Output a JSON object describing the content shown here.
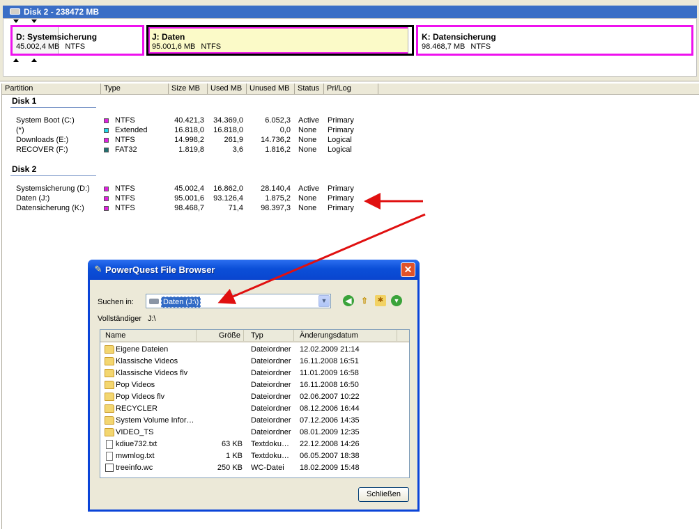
{
  "disk_map": {
    "header": "Disk 2 - 238472 MB",
    "partitions": [
      {
        "name": "D:  Systemsicherung",
        "size": "45.002,4 MB",
        "fs": "NTFS"
      },
      {
        "name": "J:  Daten",
        "size": "95.001,6 MB",
        "fs": "NTFS"
      },
      {
        "name": "K:  Datensicherung",
        "size": "98.468,7 MB",
        "fs": "NTFS"
      }
    ]
  },
  "list": {
    "columns": [
      "Partition",
      "Type",
      "Size MB",
      "Used MB",
      "Unused MB",
      "Status",
      "Pri/Log"
    ],
    "groups": [
      {
        "title": "Disk 1",
        "rows": [
          {
            "partition": "System Boot (C:)",
            "color": "#e020e0",
            "type": "NTFS",
            "size": "40.421,3",
            "used": "34.369,0",
            "unused": "6.052,3",
            "status": "Active",
            "prilog": "Primary"
          },
          {
            "partition": "(*)",
            "color": "#20d8e8",
            "type": "Extended",
            "size": "16.818,0",
            "used": "16.818,0",
            "unused": "0,0",
            "status": "None",
            "prilog": "Primary"
          },
          {
            "partition": "Downloads (E:)",
            "color": "#e020e0",
            "type": "NTFS",
            "size": "14.998,2",
            "used": "261,9",
            "unused": "14.736,2",
            "status": "None",
            "prilog": "Logical"
          },
          {
            "partition": "RECOVER (F:)",
            "color": "#207070",
            "type": "FAT32",
            "size": "1.819,8",
            "used": "3,6",
            "unused": "1.816,2",
            "status": "None",
            "prilog": "Logical"
          }
        ]
      },
      {
        "title": "Disk 2",
        "rows": [
          {
            "partition": "Systemsicherung (D:)",
            "color": "#e020e0",
            "type": "NTFS",
            "size": "45.002,4",
            "used": "16.862,0",
            "unused": "28.140,4",
            "status": "Active",
            "prilog": "Primary"
          },
          {
            "partition": "Daten (J:)",
            "color": "#e020e0",
            "type": "NTFS",
            "size": "95.001,6",
            "used": "93.126,4",
            "unused": "1.875,2",
            "status": "None",
            "prilog": "Primary"
          },
          {
            "partition": "Datensicherung (K:)",
            "color": "#e020e0",
            "type": "NTFS",
            "size": "98.468,7",
            "used": "71,4",
            "unused": "98.397,3",
            "status": "None",
            "prilog": "Primary"
          }
        ]
      }
    ]
  },
  "dialog": {
    "title": "PowerQuest File Browser",
    "lookin_label": "Suchen in:",
    "lookin_value": "Daten (J:\\)",
    "fullpath_label": "Vollständiger",
    "fullpath_value": "J:\\",
    "columns": {
      "name": "Name",
      "size": "Größe",
      "type": "Typ",
      "date": "Änderungsdatum"
    },
    "files": [
      {
        "icon": "folder-icon",
        "name": "Eigene Dateien",
        "size": "",
        "type": "Dateiordner",
        "date": "12.02.2009 21:14"
      },
      {
        "icon": "folder-icon",
        "name": "Klassische Videos",
        "size": "",
        "type": "Dateiordner",
        "date": "16.11.2008 16:51"
      },
      {
        "icon": "folder-icon",
        "name": "Klassische Videos flv",
        "size": "",
        "type": "Dateiordner",
        "date": "11.01.2009 16:58"
      },
      {
        "icon": "folder-icon",
        "name": "Pop Videos",
        "size": "",
        "type": "Dateiordner",
        "date": "16.11.2008 16:50"
      },
      {
        "icon": "folder-icon",
        "name": "Pop Videos flv",
        "size": "",
        "type": "Dateiordner",
        "date": "02.06.2007 10:22"
      },
      {
        "icon": "folder-icon",
        "name": "RECYCLER",
        "size": "",
        "type": "Dateiordner",
        "date": "08.12.2006 16:44"
      },
      {
        "icon": "folder-icon",
        "name": "System Volume Infor…",
        "size": "",
        "type": "Dateiordner",
        "date": "07.12.2006 14:35"
      },
      {
        "icon": "folder-icon",
        "name": "VIDEO_TS",
        "size": "",
        "type": "Dateiordner",
        "date": "08.01.2009 12:35"
      },
      {
        "icon": "text-file-icon",
        "name": "kdiue732.txt",
        "size": "63 KB",
        "type": "Textdoku…",
        "date": "22.12.2008 14:26"
      },
      {
        "icon": "text-file-icon",
        "name": "mwmlog.txt",
        "size": "1 KB",
        "type": "Textdoku…",
        "date": "06.05.2007 18:38"
      },
      {
        "icon": "wc-file-icon",
        "name": "treeinfo.wc",
        "size": "250 KB",
        "type": "WC-Datei",
        "date": "18.02.2009 15:48"
      }
    ],
    "close_button": "Schließen"
  },
  "colors": {
    "accent": "#316ac5",
    "partition_highlight": "#ee11ee",
    "annotation_arrow": "#e01010",
    "titlebar": "#0a4fd8"
  }
}
